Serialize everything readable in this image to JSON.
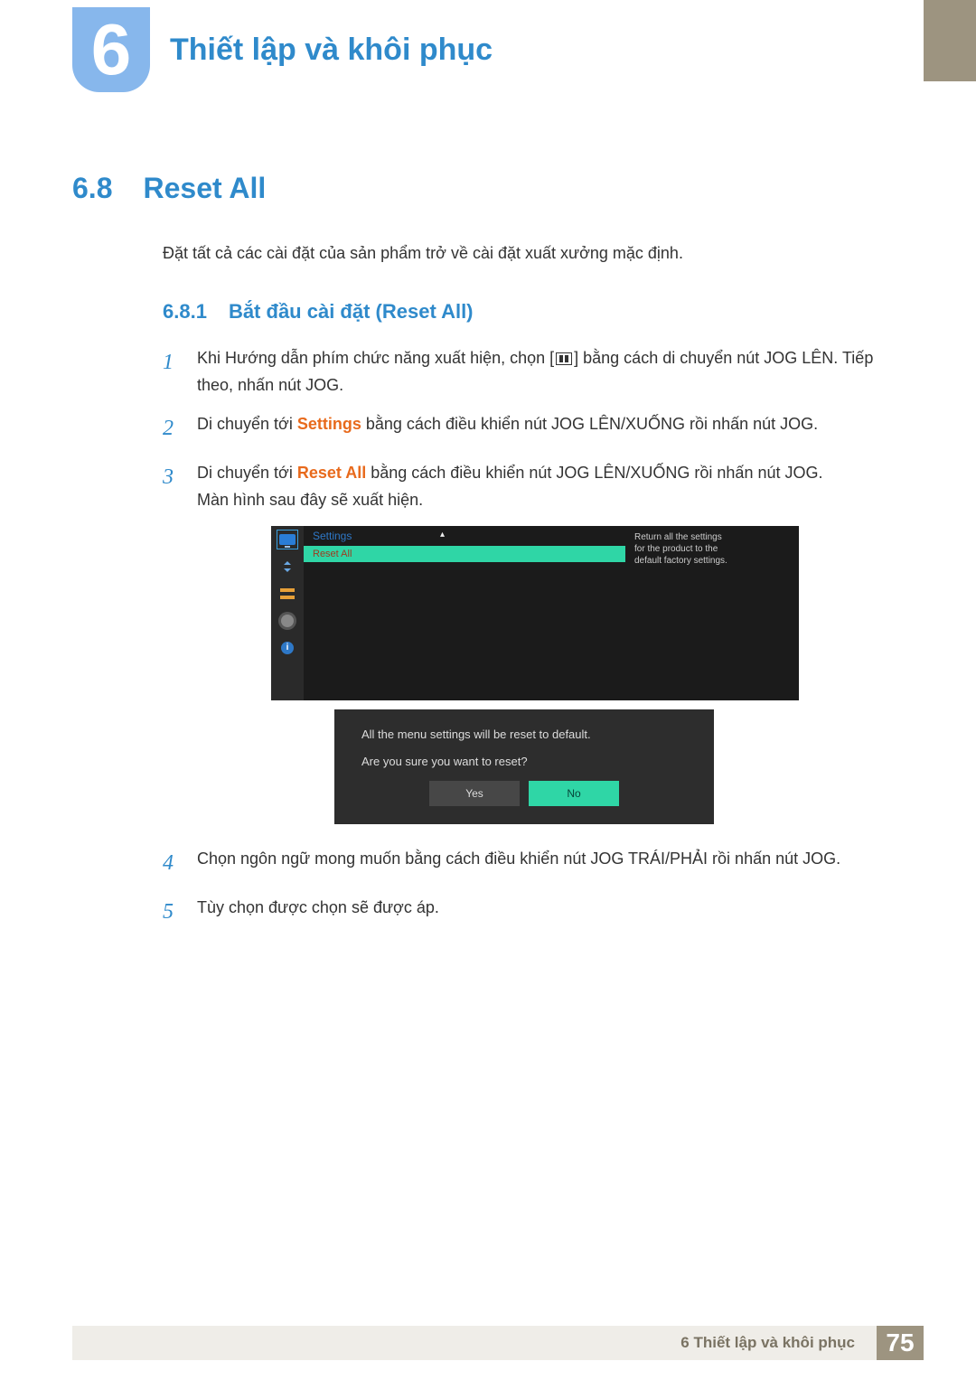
{
  "chapter": {
    "number": "6",
    "title": "Thiết lập và khôi phục"
  },
  "section": {
    "number": "6.8",
    "title": "Reset All"
  },
  "intro": "Đặt tất cả các cài đặt của sản phẩm trở về cài đặt xuất xưởng mặc định.",
  "sub": {
    "number": "6.8.1",
    "title": "Bắt đầu cài đặt (Reset All)"
  },
  "steps": {
    "s1": {
      "num": "1",
      "before": "Khi Hướng dẫn phím chức năng xuất hiện, chọn [",
      "after": "] bằng cách di chuyển nút JOG LÊN. Tiếp theo, nhấn nút JOG."
    },
    "s2": {
      "num": "2",
      "before": "Di chuyển tới ",
      "kw": "Settings",
      "after": " bằng cách điều khiển nút JOG LÊN/XUỐNG rồi nhấn nút JOG."
    },
    "s3": {
      "num": "3",
      "before": "Di chuyển tới ",
      "kw": "Reset All",
      "after": " bằng cách điều khiển nút JOG LÊN/XUỐNG rồi nhấn nút JOG.",
      "extra": "Màn hình sau đây sẽ xuất hiện."
    },
    "s4": {
      "num": "4",
      "text": "Chọn ngôn ngữ mong muốn bằng cách điều khiển nút JOG TRÁI/PHẢI rồi nhấn nút JOG."
    },
    "s5": {
      "num": "5",
      "text": "Tùy chọn được chọn sẽ được áp."
    }
  },
  "osd": {
    "heading": "Settings",
    "item": "Reset All",
    "tip_l1": "Return all the settings",
    "tip_l2": "for the product to the",
    "tip_l3": "default factory settings.",
    "info_glyph": "i"
  },
  "dialog": {
    "line1": "All the menu settings will be reset to default.",
    "line2": "Are you sure you want to reset?",
    "yes": "Yes",
    "no": "No"
  },
  "footer": {
    "text": "6 Thiết lập và khôi phục",
    "page": "75"
  }
}
